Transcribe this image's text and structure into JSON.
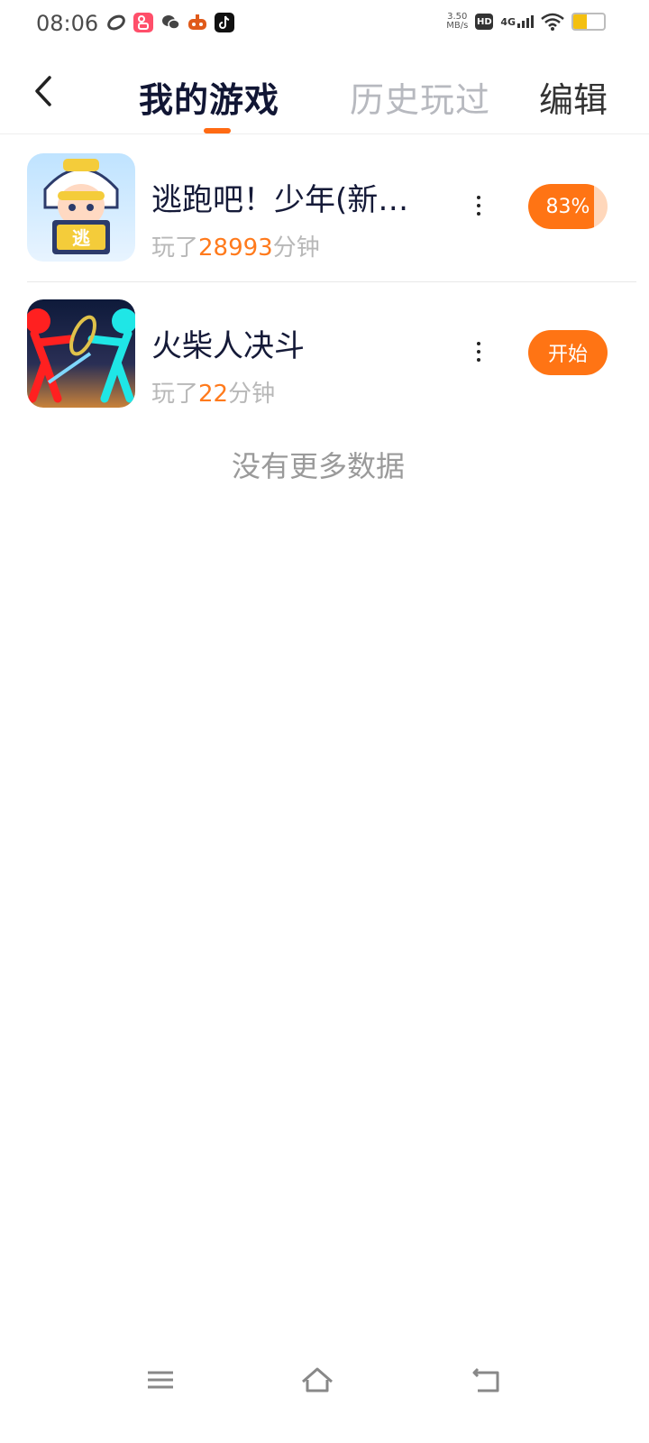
{
  "status_bar": {
    "time": "08:06",
    "speed_value": "3.50",
    "speed_unit": "MB/s",
    "hd": "HD",
    "network": "4G",
    "battery_percent": 45,
    "battery_color": "#f4c010",
    "app_icons": [
      "sync-icon",
      "kuaishou-icon",
      "wechat-icon",
      "game-icon",
      "tiktok-icon"
    ]
  },
  "header": {
    "tabs": [
      {
        "label": "我的游戏",
        "active": true
      },
      {
        "label": "历史玩过",
        "active": false
      }
    ],
    "edit_label": "编辑",
    "accent_color": "#ff6a13"
  },
  "games": [
    {
      "title": "逃跑吧！少年(新…",
      "played_prefix": "玩了",
      "played_minutes": "28993",
      "played_suffix": "分钟",
      "action": {
        "type": "progress",
        "label": "83%",
        "progress": 0.83
      }
    },
    {
      "title": "火柴人决斗",
      "played_prefix": "玩了",
      "played_minutes": "22",
      "played_suffix": "分钟",
      "action": {
        "type": "start",
        "label": "开始"
      }
    }
  ],
  "footer_text": "没有更多数据",
  "nav_bar": {
    "icons": [
      "menu-icon",
      "home-icon",
      "back-icon"
    ]
  }
}
